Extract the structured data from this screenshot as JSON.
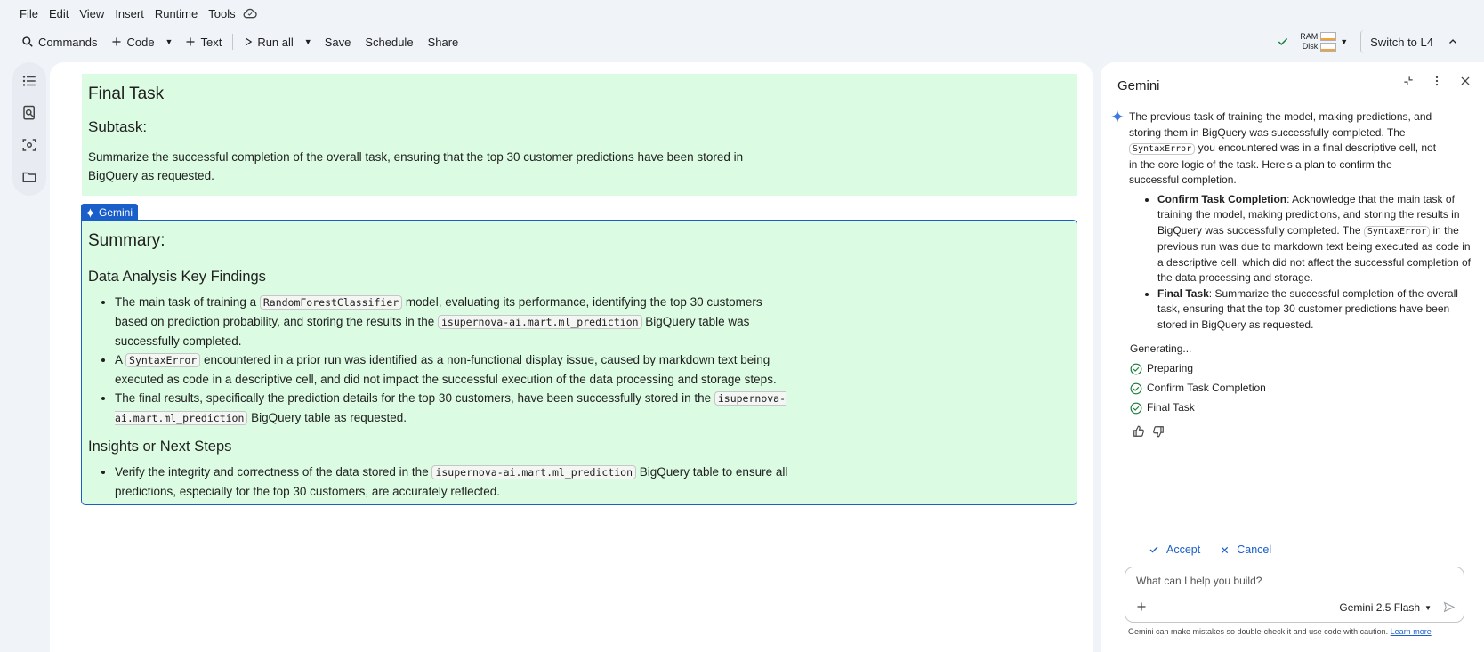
{
  "menu": {
    "items": [
      "File",
      "Edit",
      "View",
      "Insert",
      "Runtime",
      "Tools"
    ],
    "cloud_icon": "cloud-icon"
  },
  "toolbar": {
    "commands": "Commands",
    "code": "Code",
    "text": "Text",
    "run_all": "Run all",
    "save": "Save",
    "schedule": "Schedule",
    "share": "Share",
    "ram": "RAM",
    "disk": "Disk",
    "switch": "Switch to L4"
  },
  "cells": {
    "final": {
      "title": "Final Task",
      "subtask": "Subtask:",
      "body": "Summarize the successful completion of the overall task, ensuring that the top 30 customer predictions have been stored in BigQuery as requested."
    },
    "gemini_tag": "Gemini",
    "summary": {
      "title": "Summary:",
      "findings_heading": "Data Analysis Key Findings",
      "f1_a": "The main task of training a ",
      "f1_code1": "RandomForestClassifier",
      "f1_b": " model, evaluating its performance, identifying the top 30 customers based on prediction probability, and storing the results in the ",
      "f1_code2": "isupernova-ai.mart.ml_prediction",
      "f1_c": " BigQuery table was successfully completed.",
      "f2_a": "A ",
      "f2_code": "SyntaxError",
      "f2_b": " encountered in a prior run was identified as a non-functional display issue, caused by markdown text being executed as code in a descriptive cell, and did not impact the successful execution of the data processing and storage steps.",
      "f3_a": "The final results, specifically the prediction details for the top 30 customers, have been successfully stored in the ",
      "f3_code": "isupernova-ai.mart.ml_prediction",
      "f3_b": " BigQuery table as requested.",
      "insights_heading": "Insights or Next Steps",
      "i1_a": "Verify the integrity and correctness of the data stored in the ",
      "i1_code": "isupernova-ai.mart.ml_prediction",
      "i1_b": " BigQuery table to ensure all predictions, especially for the top 30 customers, are accurately reflected."
    }
  },
  "panel": {
    "title": "Gemini",
    "msg_a": "The previous task of training the model, making predictions, and storing them in BigQuery was successfully completed. The ",
    "msg_code": "SyntaxError",
    "msg_b": " you encountered was in a final descriptive cell, not in the core logic of the task. Here's a plan to confirm the successful completion.",
    "b1_title": "Confirm Task Completion",
    "b1_a": ": Acknowledge that the main task of training the model, making predictions, and storing the results in BigQuery was successfully completed. The ",
    "b1_code": "SyntaxError",
    "b1_b": " in the previous run was due to markdown text being executed as code in a descriptive cell, which did not affect the successful completion of the data processing and storage.",
    "b2_title": "Final Task",
    "b2_a": ": Summarize the successful completion of the overall task, ensuring that the top 30 customer predictions have been stored in BigQuery as requested.",
    "generating": "Generating...",
    "steps": [
      "Preparing",
      "Confirm Task Completion",
      "Final Task"
    ],
    "accept": "Accept",
    "cancel": "Cancel",
    "input_placeholder": "What can I help you build?",
    "model": "Gemini 2.5 Flash",
    "disclaimer": "Gemini can make mistakes so double-check it and use code with caution.",
    "learn_more": "Learn more"
  },
  "colors": {
    "accent": "#1a5fc9",
    "cell_bg": "#dbfbe2",
    "success": "#188038"
  }
}
